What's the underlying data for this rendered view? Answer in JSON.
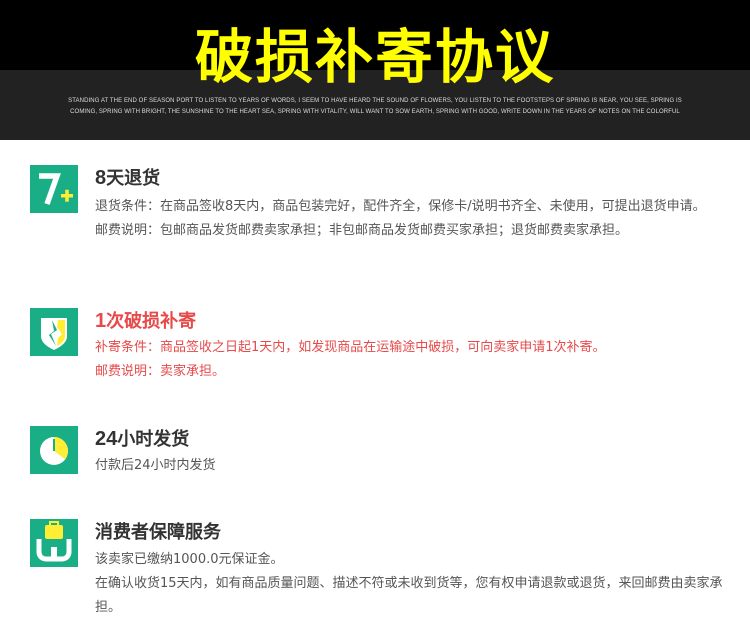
{
  "banner": {
    "title": "破损补寄协议",
    "subtitle": "STANDING AT THE END OF SEASON PORT TO LISTEN TO YEARS OF WORDS, I SEEM TO HAVE HEARD THE SOUND OF FLOWERS, YOU LISTEN TO THE FOOTSTEPS OF SPRING IS NEAR, YOU SEE, SPRING IS COMING, SPRING WITH BRIGHT, THE SUNSHINE TO THE HEART SEA, SPRING WITH VITALITY, WILL WANT TO SOW EARTH, SPRING WITH GOOD, WRITE DOWN IN THE YEARS OF NOTES ON THE COLORFUL"
  },
  "colors": {
    "icon_bg": "#1aae86",
    "icon_accent": "#ffee33",
    "highlight_red": "#e64a4a",
    "title_yellow": "#ffff00"
  },
  "sections": [
    {
      "icon": "seven-plus-icon",
      "title_lead": "8",
      "title_rest": "天退货",
      "lines": [
        "退货条件：在商品签收8天内，商品包装完好，配件齐全，保修卡/说明书齐全、未使用，可提出退货申请。",
        "邮费说明：包邮商品发货邮费卖家承担；非包邮商品发货邮费买家承担；退货邮费卖家承担。"
      ]
    },
    {
      "icon": "broken-shield-icon",
      "title_lead": "1",
      "title_rest": "次破损补寄",
      "lines": [
        "补寄条件：商品签收之日起1天内，如发现商品在运输途中破损，可向卖家申请1次补寄。",
        "邮费说明：卖家承担。"
      ]
    },
    {
      "icon": "clock-icon",
      "title_lead": "24",
      "title_rest": "小时发货",
      "lines": [
        "付款后24小时内发货"
      ]
    },
    {
      "icon": "guarantee-bag-icon",
      "title_lead": "",
      "title_rest": "消费者保障服务",
      "lines": [
        "该卖家已缴纳1000.0元保证金。",
        "在确认收货15天内，如有商品质量问题、描述不符或未收到货等，您有权申请退款或退货，来回邮费由卖家承担。"
      ]
    }
  ]
}
